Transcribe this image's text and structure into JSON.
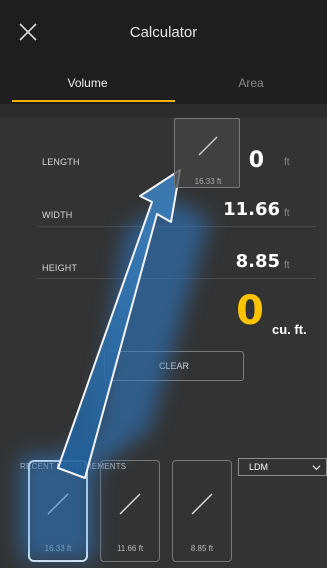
{
  "header": {
    "title": "Calculator"
  },
  "tabs": [
    {
      "label": "Volume"
    },
    {
      "label": "Area"
    }
  ],
  "rows": [
    {
      "label": "LENGTH",
      "value": "0",
      "unit": "ft"
    },
    {
      "label": "WIDTH",
      "value": "11.66",
      "unit": "ft"
    },
    {
      "label": "HEIGHT",
      "value": "8.85",
      "unit": "ft"
    }
  ],
  "result": {
    "value": "0",
    "unit": "cu. ft."
  },
  "clear_label": "CLEAR",
  "recent": {
    "label": "RECENT MEASUREMENTS",
    "filter_value": "LDM",
    "items": [
      {
        "caption": "16.33 ft"
      },
      {
        "caption": "11.66 ft"
      },
      {
        "caption": "8.85 ft"
      }
    ]
  },
  "drag_card": {
    "caption": "16.33 ft"
  },
  "colors": {
    "accent": "#f2b100",
    "result": "#ffc400",
    "arrow": "#3f86c6"
  },
  "icons": [
    "close-icon",
    "diagonal-measure-icon",
    "chevron-down-icon"
  ]
}
